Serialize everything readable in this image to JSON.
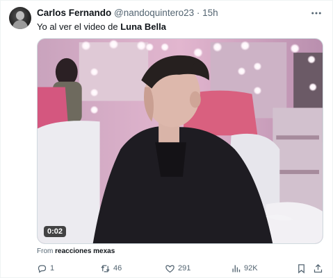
{
  "tweet": {
    "author_name": "Carlos Fernando",
    "author_handle": "@nandoquintero23",
    "separator": "·",
    "time": "15h",
    "text_prefix": "Yo al ver el video de ",
    "text_bold": "Luna Bella"
  },
  "media": {
    "duration": "0:02"
  },
  "source": {
    "label": "From",
    "name": "reacciones mexas"
  },
  "actions": {
    "replies": "1",
    "retweets": "46",
    "likes": "291",
    "views": "92K"
  },
  "icons": {
    "more": "more-horizontal-icon",
    "reply": "reply-icon",
    "retweet": "retweet-icon",
    "like": "heart-icon",
    "views": "views-chart-icon",
    "bookmark": "bookmark-icon",
    "share": "share-icon"
  },
  "colors": {
    "text_primary": "#0f1419",
    "text_secondary": "#536471",
    "border": "#cfd9de"
  }
}
